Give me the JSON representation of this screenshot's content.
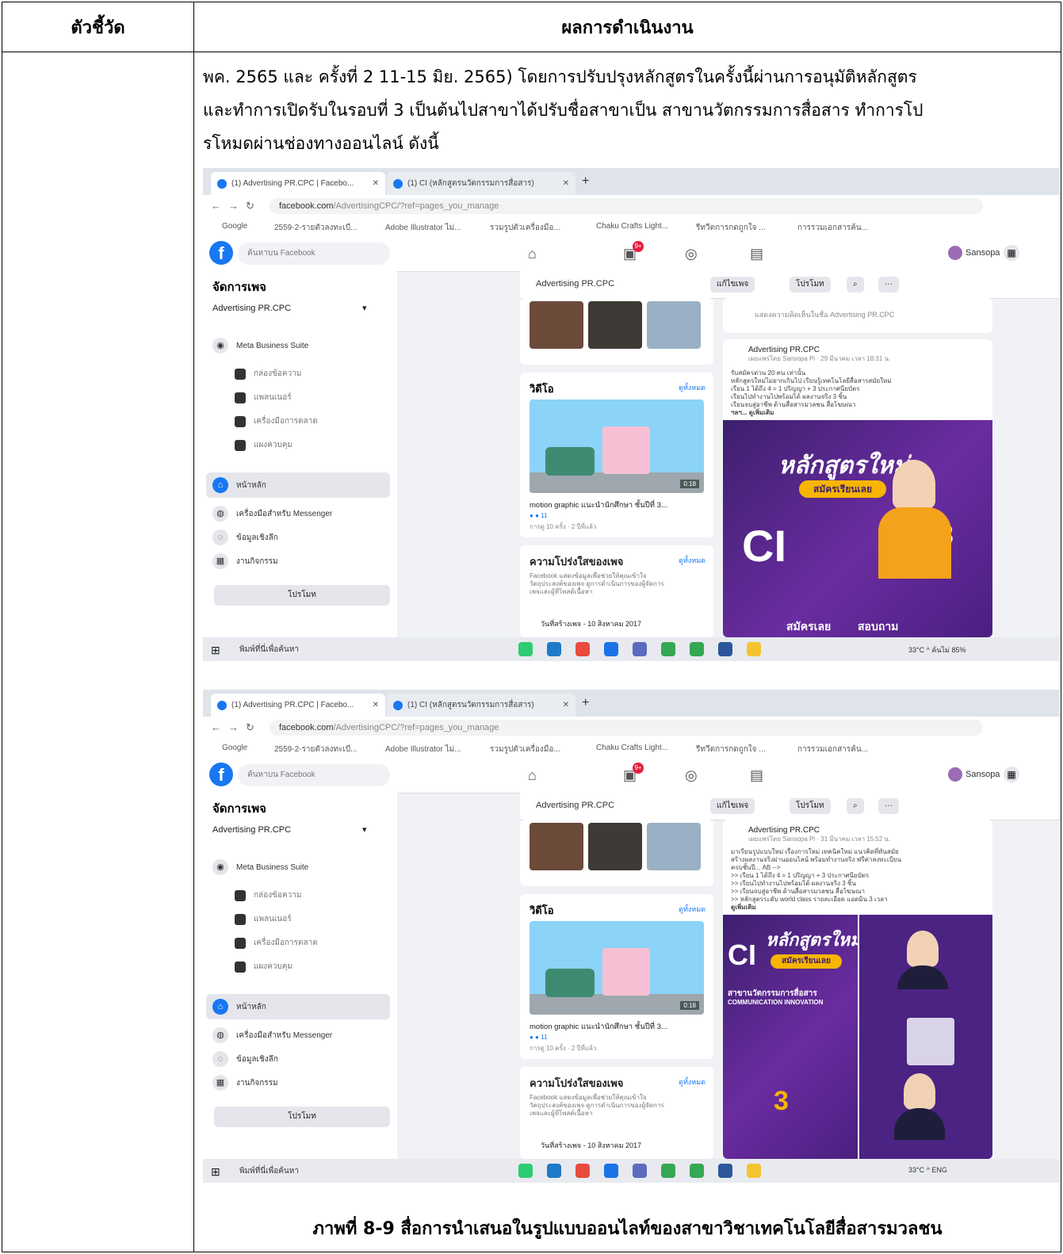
{
  "table": {
    "header_left": "ตัวชี้วัด",
    "header_right": "ผลการดำเนินงาน"
  },
  "paragraph": [
    "พค. 2565 และ ครั้งที่ 2 11-15 มิย. 2565) โดยการปรับปรุงหลักสูตรในครั้งนี้ผ่านการอนุมัติหลักสูตร",
    "และทำการเปิดรับในรอบที่ 3 เป็นต้นไปสาขาได้ปรับชื่อสาขาเป็น สาขานวัตกรรมการสื่อสาร ทำการโป",
    "รโหมดผ่านช่องทางออนไลน์ ดังนี้"
  ],
  "caption": "ภาพที่ 8-9 สื่อการนำเสนอในรูปแบบออนไลท์ของสาขาวิชาเทคโนโลยีสื่อสารมวลชน",
  "screenshot": {
    "tabs": [
      "(1) Advertising PR.CPC | Facebo...",
      "(1) CI (หลักสูตรนวัตกรรมการสื่อสาร)"
    ],
    "url_host": "facebook.com",
    "url_path": "/AdvertisingCPC/?ref=pages_you_manage",
    "bookmarks": [
      "Google",
      "2559-2-รายตัวลงทะเบี...",
      "Adobe Illustrator ไม่...",
      "รวมรูปตัวเครื่องมือ...",
      "Chaku Crafts Light...",
      "รีทวีตการกดถูกใจ ...",
      "การรวมเอกสารค้น..."
    ],
    "search_placeholder": "ค้นหาบน Facebook",
    "badge_notif": "9+",
    "profile_name": "Sansopa",
    "sidebar_title": "จัดการเพจ",
    "page_name": "Advertising PR.CPC",
    "meta_suite": "Meta Business Suite",
    "sub_items": [
      "กล่องข้อความ",
      "แพลนเนอร์",
      "เครื่องมือการตลาด",
      "แผงควบคุม"
    ],
    "nav_items": [
      "หน้าหลัก",
      "เครื่องมือสำหรับ Messenger",
      "ข้อมูลเชิงลึก",
      "งานกิจกรรม"
    ],
    "promote": "โปรโมท",
    "pagebar_buttons": [
      "แก้ไขเพจ",
      "โปรโมท",
      "⌕",
      "···"
    ],
    "video_section": "วิดีโอ",
    "see_all": "ดูทั้งหมด",
    "video_duration": "0:18",
    "video_title": "motion graphic แนะนำนักศึกษา ชั้นปีที่ 3...",
    "video_views": "การดู 10 ครั้ง · 2 ปีที่แล้ว",
    "transparency": "ความโปร่งใสของเพจ",
    "transparency_text": [
      "Facebook แสดงข้อมูลเพื่อช่วยให้คุณเข้าใจ",
      "วัตถุประสงค์ของเพจ ดูการดำเนินการของผู้จัดการ",
      "เพจและผู้ที่โพสต์เนื้อหา"
    ],
    "created_date": "วันที่สร้างเพจ - 10 สิงหาคม 2017",
    "poster_headline": "หลักสูตรใหม่",
    "poster_pill": "สมัครเรียนเลย",
    "poster_ci": "CI",
    "poster_number": "3",
    "poster_footer_left": "สมัครเลย",
    "poster_footer_right": "สอบถาม",
    "poster2_banner": "สาขานวัตกรรมการสื่อสาร",
    "poster2_sub": "COMMUNICATION INNOVATION",
    "compose_placeholder": "แสดงความคิดเห็นในชื่อ Advertising PR.CPC",
    "post1_meta": "เผยแพร่โดย Sansopa Pi · 29 มีนาคม เวลา 18:31 น.",
    "post2_meta": "เผยแพร่โดย Sansopa Pi · 31 มีนาคม เวลา 15:52 น.",
    "post1_lines": [
      "รับสมัครด่วน 20 คน เท่านั้น",
      "หลักสูตรใหม่ไม่ยากเกินไป เรียนรู้เทคโนโลยีสื่อสารสมัยใหม่",
      "เรียน 1 ได้ถึง 4 = 1 ปริญญา + 3 ประกาศนียบัตร",
      "เรียนไปทำงานไปพร้อมได้ ผลงานจริง 3 ชิ้น",
      "เรียนจบสู่อาชีพ ด้านสื่อสารมวลชน สื่อโฆษณา",
      "ฯลฯ... ดูเพิ่มเติม"
    ],
    "post2_lines": [
      "มาเรียนรูปแบบใหม่ เรื่องการใหม่ เทคนิคใหม่ แนวคิดที่ทันสมัย",
      "สร้างผลงานจริงผ่านออนไลน์ พร้อมทำงานจริง ฟรีค่าลงทะเบียน",
      "ครบชั้นปี... AB -->",
      ">> เรียน 1 ได้ถึง 4 = 1 ปริญญา + 3 ประกาศนียบัตร",
      ">> เรียนไปทำงานไปพร้อมได้ ผลงานจริง 3 ชิ้น",
      ">> เรียนจบสู่อาชีพ ด้านสื่อสารมวลชน สื่อโฆษณา",
      ">> หลักสูตรระดับ world class รายละเอียด แอดมิน 3 เวลา",
      "ดูเพิ่มเติม"
    ],
    "taskbar_search": "พิมพ์ที่นี่เพื่อค้นหา",
    "tray_temp": "33°C",
    "tray_lang": "ENG",
    "tray_zoom": "ค้นไม่ 85%"
  },
  "colors": {
    "fb_blue": "#1877f2",
    "poster_purple": "#5b2a91",
    "poster_yellow": "#f7b500"
  }
}
